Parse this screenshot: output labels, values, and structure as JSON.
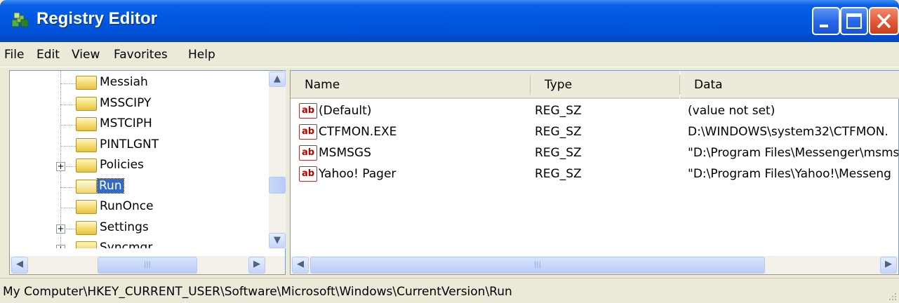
{
  "window": {
    "title": "Registry Editor",
    "icon": "regedit-icon"
  },
  "menu": [
    "File",
    "Edit",
    "View",
    "Favorites",
    "Help"
  ],
  "tree": {
    "items": [
      {
        "label": "Messiah",
        "expandable": false,
        "selected": false
      },
      {
        "label": "MSSCIPY",
        "expandable": false,
        "selected": false
      },
      {
        "label": "MSTCIPH",
        "expandable": false,
        "selected": false
      },
      {
        "label": "PINTLGNT",
        "expandable": false,
        "selected": false
      },
      {
        "label": "Policies",
        "expandable": true,
        "selected": false
      },
      {
        "label": "Run",
        "expandable": false,
        "selected": true
      },
      {
        "label": "RunOnce",
        "expandable": false,
        "selected": false
      },
      {
        "label": "Settings",
        "expandable": true,
        "selected": false
      },
      {
        "label": "Syncmgr",
        "expandable": true,
        "selected": false
      }
    ]
  },
  "values": {
    "columns": [
      "Name",
      "Type",
      "Data"
    ],
    "rows": [
      {
        "name": "(Default)",
        "type": "REG_SZ",
        "data": "(value not set)"
      },
      {
        "name": "CTFMON.EXE",
        "type": "REG_SZ",
        "data": "D:\\WINDOWS\\system32\\CTFMON."
      },
      {
        "name": "MSMSGS",
        "type": "REG_SZ",
        "data": "\"D:\\Program Files\\Messenger\\msms"
      },
      {
        "name": "Yahoo! Pager",
        "type": "REG_SZ",
        "data": "\"D:\\Program Files\\Yahoo!\\Messeng"
      }
    ],
    "value_icon_text": "ab"
  },
  "status": {
    "path": "My Computer\\HKEY_CURRENT_USER\\Software\\Microsoft\\Windows\\CurrentVersion\\Run"
  },
  "colors": {
    "titlebar": "#0058e3",
    "selection": "#316ac5",
    "close_button": "#e35a3a"
  }
}
